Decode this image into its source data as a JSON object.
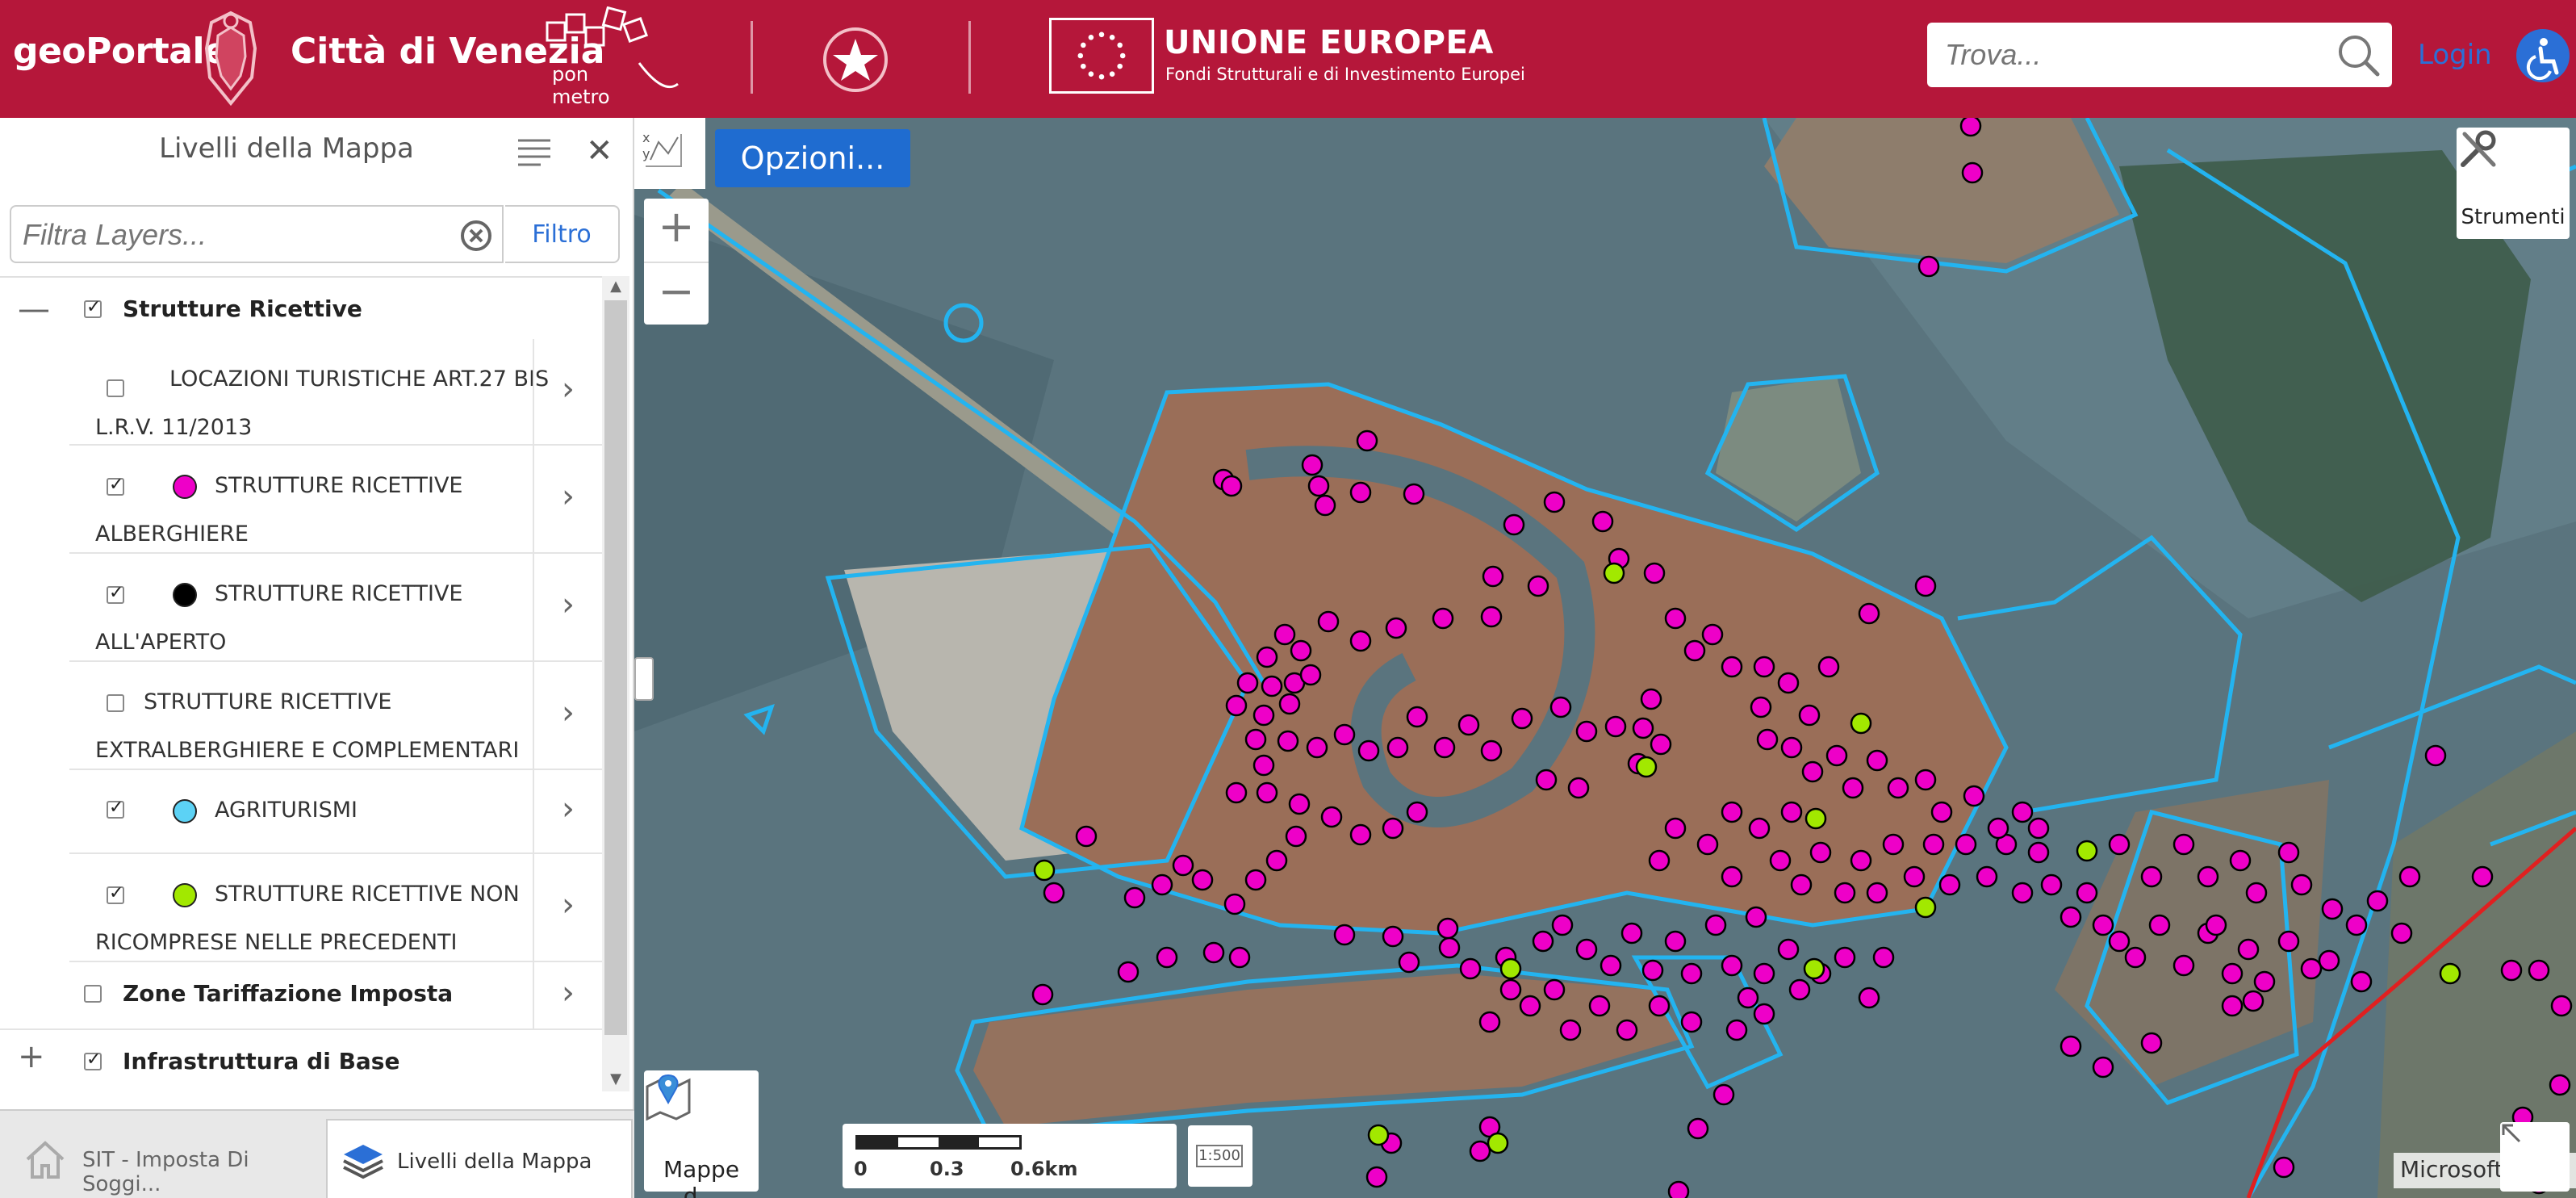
{
  "header": {
    "brand": "geoPortale",
    "city": "Città di Venezia",
    "ponmetro_top": "pon",
    "ponmetro_bottom": "metro",
    "eu_title": "UNIONE EUROPEA",
    "eu_subtitle": "Fondi Strutturali e di Investimento Europei",
    "search_placeholder": "Trova...",
    "login": "Login",
    "icons": [
      "crest-icon",
      "ponmetro-logo",
      "republic-emblem-icon",
      "eu-flag-icon",
      "search-icon",
      "accessibility-icon"
    ]
  },
  "colors": {
    "header_bg": "#b5173a",
    "link_blue": "#2b6fd6",
    "marker_magenta": "#ee00c8",
    "marker_green": "#a2e800",
    "marker_cyan": "#5cd2f5",
    "boundary_blue": "#23b4f0",
    "boundary_red": "#e02020"
  },
  "panel": {
    "title": "Livelli della Mappa",
    "filter_placeholder": "Filtra Layers...",
    "filter_button": "Filtro",
    "groups": [
      {
        "label": "Strutture Ricettive",
        "checked": true,
        "expanded": true
      },
      {
        "label": "Zone Tariffazione Imposta",
        "checked": false,
        "expanded": false
      },
      {
        "label": "Infrastruttura di Base",
        "checked": true,
        "expanded": false
      }
    ],
    "layers": [
      {
        "label": "LOCAZIONI TURISTICHE ART.27 BIS L.R.V. 11/2013",
        "checked": false,
        "legend_color": ""
      },
      {
        "label": "STRUTTURE RICETTIVE ALBERGHIERE",
        "checked": true,
        "legend_color": "#ee00c8"
      },
      {
        "label": "STRUTTURE RICETTIVE ALL'APERTO",
        "checked": true,
        "legend_color": "#000000"
      },
      {
        "label": "STRUTTURE RICETTIVE EXTRALBERGHIERE E COMPLEMENTARI",
        "checked": false,
        "legend_color": ""
      },
      {
        "label": "AGRITURISMI",
        "checked": true,
        "legend_color": "#5cd2f5"
      },
      {
        "label": "STRUTTURE RICETTIVE NON RICOMPRESE NELLE PRECEDENTI",
        "checked": true,
        "legend_color": "#a2e800"
      }
    ],
    "tabs": [
      {
        "label": "SIT - Imposta Di Soggi...",
        "icon": "home-icon",
        "active": false
      },
      {
        "label": "Livelli della Mappa",
        "icon": "layers-icon",
        "active": true
      }
    ]
  },
  "map": {
    "options_button": "Opzioni...",
    "tools_label": "Strumenti",
    "basemap_label": "Mappe d...",
    "scale_labels": [
      "0",
      "0.3",
      "0.6km"
    ],
    "ratio_label": "1:500",
    "attribution": "Microsoft, N"
  }
}
